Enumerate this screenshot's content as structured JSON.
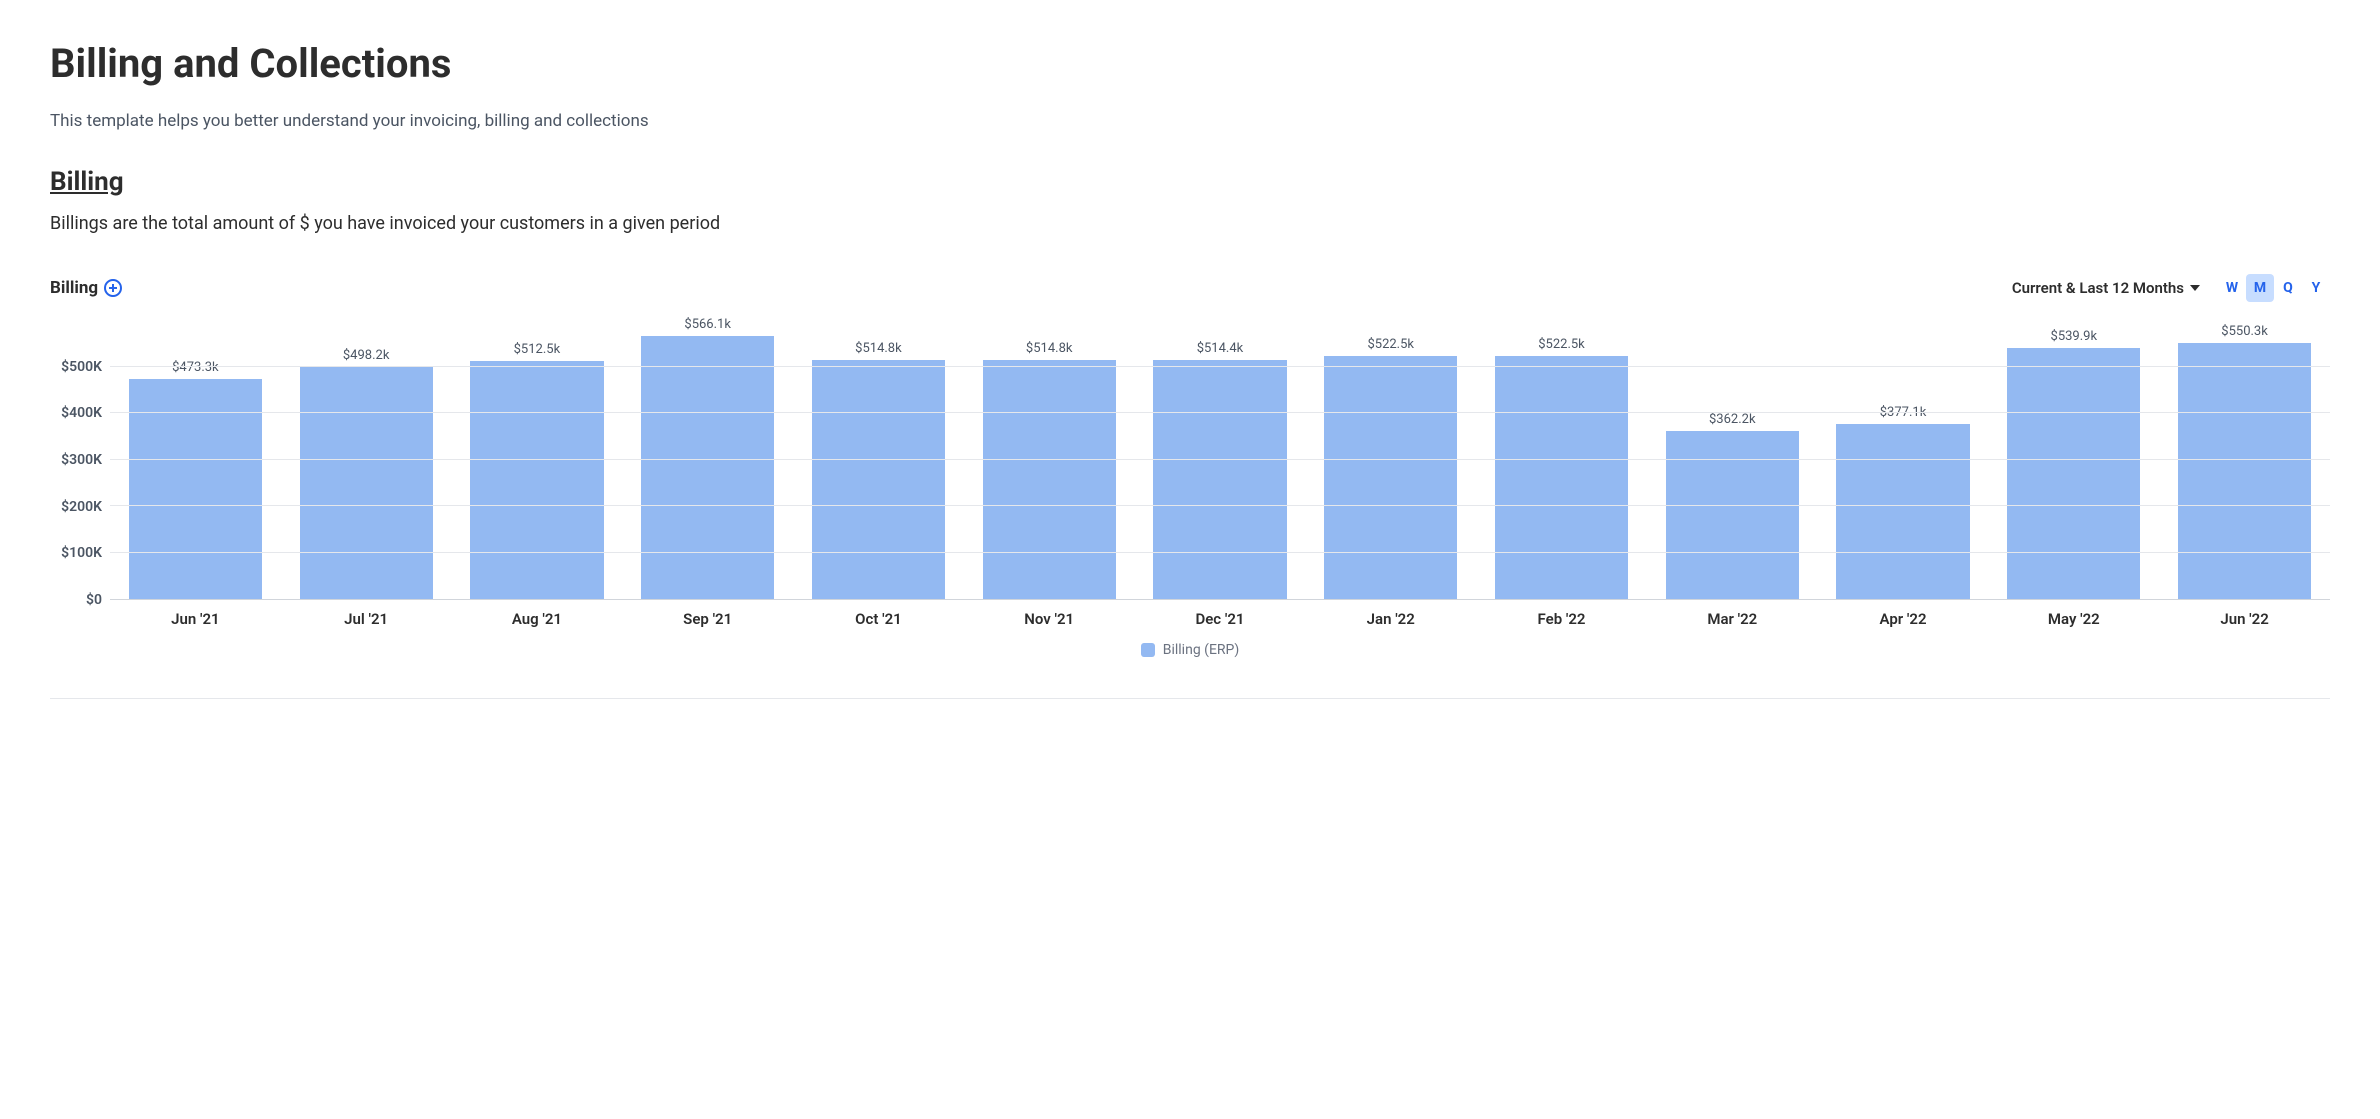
{
  "page": {
    "title": "Billing and Collections",
    "description": "This template helps you better understand your invoicing, billing and collections"
  },
  "section": {
    "heading": "Billing",
    "description": "Billings are the total amount of $ you have invoiced your customers in a given period"
  },
  "chart": {
    "title": "Billing",
    "period_label": "Current & Last 12 Months",
    "granularity": {
      "options": [
        "W",
        "M",
        "Q",
        "Y"
      ],
      "active": "M"
    },
    "legend": "Billing (ERP)"
  },
  "chart_data": {
    "type": "bar",
    "title": "Billing",
    "xlabel": "",
    "ylabel": "",
    "ylim": [
      0,
      600000
    ],
    "y_ticks": [
      "$0",
      "$100K",
      "$200K",
      "$300K",
      "$400K",
      "$500K"
    ],
    "categories": [
      "Jun '21",
      "Jul '21",
      "Aug '21",
      "Sep '21",
      "Oct '21",
      "Nov '21",
      "Dec '21",
      "Jan '22",
      "Feb '22",
      "Mar '22",
      "Apr '22",
      "May '22",
      "Jun '22"
    ],
    "values": [
      473300,
      498200,
      512500,
      566100,
      514800,
      514800,
      514400,
      522500,
      522500,
      362200,
      377100,
      539900,
      550300
    ],
    "value_labels": [
      "$473.3k",
      "$498.2k",
      "$512.5k",
      "$566.1k",
      "$514.8k",
      "$514.8k",
      "$514.4k",
      "$522.5k",
      "$522.5k",
      "$362.2k",
      "$377.1k",
      "$539.9k",
      "$550.3k"
    ],
    "series": [
      {
        "name": "Billing (ERP)",
        "values": [
          473300,
          498200,
          512500,
          566100,
          514800,
          514800,
          514400,
          522500,
          522500,
          362200,
          377100,
          539900,
          550300
        ]
      }
    ],
    "bar_color": "#93b9f2"
  }
}
